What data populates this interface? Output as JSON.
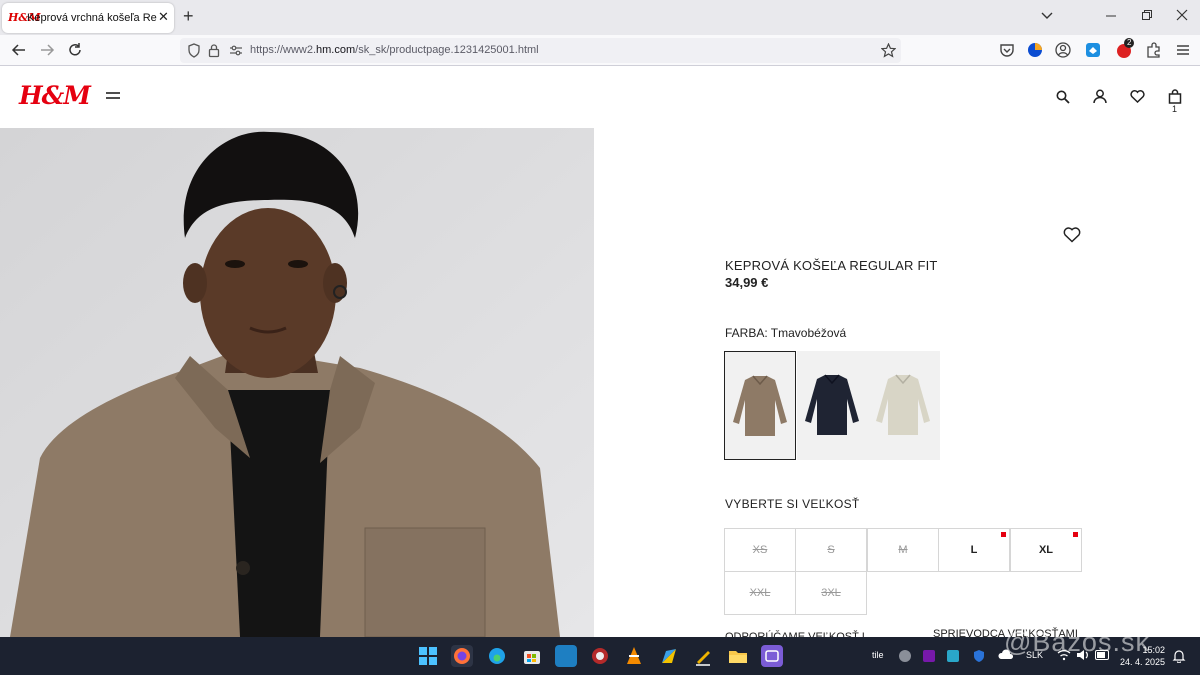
{
  "browser": {
    "tab_title": "Keprová vrchná košeľa Regular",
    "tab_favicon": "H&M",
    "url_prefix": "https://www2.",
    "url_domain": "hm.com",
    "url_path": "/sk_sk/productpage.1231425001.html",
    "extension_badge": "2"
  },
  "header": {
    "logo": "H&M",
    "cart_count": "1"
  },
  "product": {
    "title": "KEPROVÁ KOŠEĽA REGULAR FIT",
    "price": "34,99 €",
    "color_label": "FARBA: Tmavobéžová",
    "swatches": [
      {
        "name": "Tmavobéžová",
        "color": "#8e7a66",
        "selected": true
      },
      {
        "name": "Tmavomodrá",
        "color": "#1f2433",
        "selected": false
      },
      {
        "name": "Svetlobéžová",
        "color": "#d8d5c6",
        "selected": false
      }
    ],
    "size_heading": "VYBERTE SI VEĽKOSŤ",
    "sizes": [
      {
        "label": "XS",
        "available": false
      },
      {
        "label": "S",
        "available": false
      },
      {
        "label": "M",
        "available": false
      },
      {
        "label": "L",
        "available": true,
        "low_stock": true
      },
      {
        "label": "XL",
        "available": true,
        "low_stock": true
      },
      {
        "label": "XXL",
        "available": false
      },
      {
        "label": "3XL",
        "available": false
      }
    ],
    "recommended_label": "ODPORÚČAME VEĽKOSŤ L",
    "size_guide_link": "SPRIEVODCA VEĽKOSŤAMI"
  },
  "taskbar": {
    "weather": "tile",
    "language": "SLK",
    "time": "15:02",
    "date": "24. 4. 2025"
  },
  "watermark": "@Bazos.sk",
  "colors": {
    "brand_red": "#e50010",
    "shirt": "#8e7a66",
    "taskbar": "#1c2230"
  }
}
